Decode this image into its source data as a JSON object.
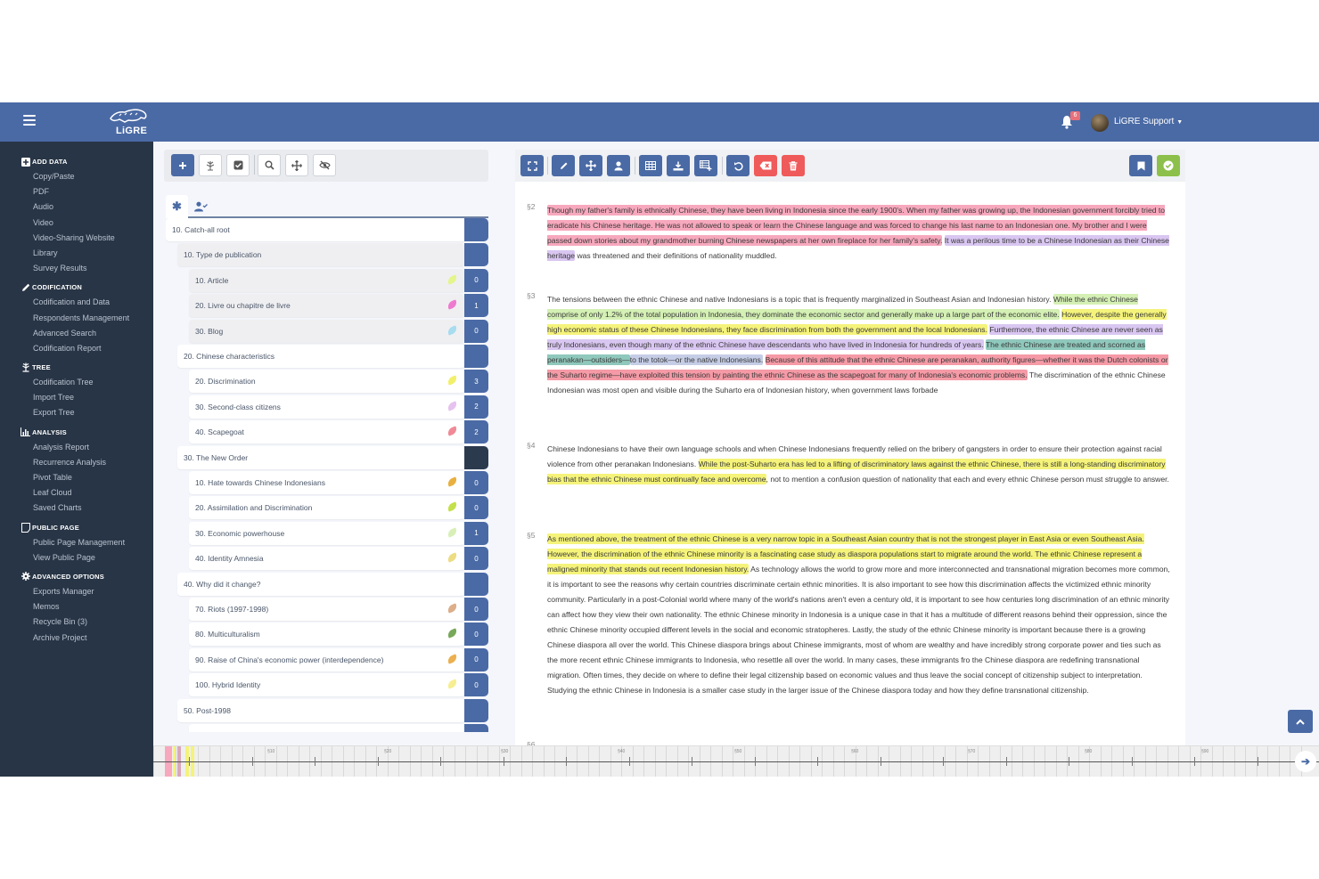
{
  "header": {
    "logo_text": "LiGRE",
    "notifications_count": "6",
    "user_name": "LiGRE Support"
  },
  "sidebar": {
    "sections": [
      {
        "title": "ADD DATA",
        "icon": "plus-square-icon",
        "items": [
          "Copy/Paste",
          "PDF",
          "Audio",
          "Video",
          "Video-Sharing Website",
          "Library",
          "Survey Results"
        ]
      },
      {
        "title": "CODIFICATION",
        "icon": "pencil-icon",
        "items": [
          "Codification and Data",
          "Respondents Management",
          "Advanced Search",
          "Codification Report"
        ]
      },
      {
        "title": "TREE",
        "icon": "tree-icon",
        "items": [
          "Codification Tree",
          "Import Tree",
          "Export Tree"
        ]
      },
      {
        "title": "ANALYSIS",
        "icon": "bar-chart-icon",
        "items": [
          "Analysis Report",
          "Recurrence Analysis",
          "Pivot Table",
          "Leaf Cloud",
          "Saved Charts"
        ]
      },
      {
        "title": "PUBLIC PAGE",
        "icon": "page-icon",
        "items": [
          "Public Page Management",
          "View Public Page"
        ]
      },
      {
        "title": "ADVANCED OPTIONS",
        "icon": "gear-icon",
        "items": [
          "Exports Manager",
          "Memos",
          "Recycle Bin (3)",
          "Archive Project"
        ]
      }
    ]
  },
  "tree_toolbar": {
    "buttons": [
      "add-icon",
      "tree-icon",
      "checkbox-icon",
      "search-icon",
      "move-icon",
      "hide-icon"
    ]
  },
  "tree_tabs": [
    "asterisk-icon",
    "user-check-icon"
  ],
  "tree": {
    "nodes": [
      {
        "label": "10. Catch-all root",
        "level": 0,
        "count": "",
        "leaf_color": ""
      },
      {
        "label": "10. Type de publication",
        "level": 1,
        "count": "",
        "leaf_color": ""
      },
      {
        "label": "10. Article",
        "level": 2,
        "count": "0",
        "leaf_color": "#e4f58a"
      },
      {
        "label": "20. Livre ou chapitre de livre",
        "level": 2,
        "count": "1",
        "leaf_color": "#ee7ad0"
      },
      {
        "label": "30. Blog",
        "level": 2,
        "count": "0",
        "leaf_color": "#a8dcef"
      },
      {
        "label": "20. Chinese characteristics",
        "level": 1,
        "count": "",
        "leaf_color": ""
      },
      {
        "label": "20. Discrimination",
        "level": 2,
        "count": "3",
        "leaf_color": "#f2f06a"
      },
      {
        "label": "30. Second-class citizens",
        "level": 2,
        "count": "2",
        "leaf_color": "#e6c2ee"
      },
      {
        "label": "40. Scapegoat",
        "level": 2,
        "count": "2",
        "leaf_color": "#f08a96"
      },
      {
        "label": "30. The New Order",
        "level": 1,
        "count": "",
        "leaf_color": "",
        "dark": true
      },
      {
        "label": "10. Hate towards Chinese Indonesians",
        "level": 2,
        "count": "0",
        "leaf_color": "#e8b040"
      },
      {
        "label": "20. Assimilation and Discrimination",
        "level": 2,
        "count": "0",
        "leaf_color": "#c4e04a"
      },
      {
        "label": "30. Economic powerhouse",
        "level": 2,
        "count": "1",
        "leaf_color": "#d8f0b8"
      },
      {
        "label": "40. Identity Amnesia",
        "level": 2,
        "count": "0",
        "leaf_color": "#ecdc84"
      },
      {
        "label": "40. Why did it change?",
        "level": 1,
        "count": "",
        "leaf_color": ""
      },
      {
        "label": "70. Riots (1997-1998)",
        "level": 2,
        "count": "0",
        "leaf_color": "#dcae8a"
      },
      {
        "label": "80. Multiculturalism",
        "level": 2,
        "count": "0",
        "leaf_color": "#78a85a"
      },
      {
        "label": "90. Raise of China's economic power (interdependence)",
        "level": 2,
        "count": "0",
        "leaf_color": "#ecb050"
      },
      {
        "label": "100. Hybrid Identity",
        "level": 2,
        "count": "0",
        "leaf_color": "#f6ee90"
      },
      {
        "label": "50. Post-1998",
        "level": 1,
        "count": "",
        "leaf_color": ""
      },
      {
        "label": "",
        "level": 2,
        "count": "",
        "leaf_color": ""
      }
    ]
  },
  "doc_toolbar": {
    "buttons": [
      "fullscreen-icon",
      "pencil-icon",
      "move-icon",
      "user-icon",
      "table-icon",
      "download-icon",
      "add-media-icon",
      "undo-icon",
      "clear-icon",
      "trash-icon"
    ],
    "right_buttons": [
      "bookmark-icon",
      "check-icon"
    ]
  },
  "document": {
    "paragraphs": [
      {
        "num": "§2",
        "segments": [
          {
            "text": "Though my father's family is ethnically Chinese, they have been living in Indonesia since the early 1900's. When my father was growing up, the Indonesian government forcibly tried to eradicate his Chinese heritage. He was not allowed to speak or learn the Chinese language and was forced to change his last name to an Indonesian one. My brother and I were passed down stories about my grandmother burning Chinese newspapers at her own fireplace for her family's safety.",
            "hl": "pink"
          },
          {
            "text": " ",
            "hl": ""
          },
          {
            "text": "It was a perilous time to be a Chinese Indonesian as their Chinese heritage",
            "hl": "lilac"
          },
          {
            "text": " was threatened and their definitions of nationality muddled.",
            "hl": ""
          }
        ]
      },
      {
        "num": "§3",
        "segments": [
          {
            "text": "The tensions between the ethnic Chinese and native Indonesians is a topic that is frequently marginalized in Southeast Asian and Indonesian history. ",
            "hl": ""
          },
          {
            "text": "While the ethnic Chinese comprise of only 1.2% of the total population in Indonesia, they dominate the economic sector and generally make up a large part of the economic elite.",
            "hl": "green"
          },
          {
            "text": " ",
            "hl": ""
          },
          {
            "text": "However, despite the generally high economic status of these Chinese Indonesians, they face discrimination from both the government and the local Indonesians.",
            "hl": "yellow"
          },
          {
            "text": " ",
            "hl": ""
          },
          {
            "text": "Furthermore, the ethnic Chinese are never seen as truly Indonesians, even though many of the ethnic Chinese have descendants who have lived in Indonesia for hundreds of years.",
            "hl": "lilac"
          },
          {
            "text": " ",
            "hl": ""
          },
          {
            "text": "The ethnic Chinese are treated and scorned as peranakan—outsiders—",
            "hl": "teal"
          },
          {
            "text": "to the totok—or the native Indonesians.",
            "hl": "blue-grey"
          },
          {
            "text": " ",
            "hl": ""
          },
          {
            "text": "Because of this attitude that the ethnic Chinese are peranakan, authority figures—whether it was the Dutch colonists or the Suharto regime—have exploited this tension by painting the ethnic Chinese as the scapegoat for many of Indonesia's economic problems.",
            "hl": "red"
          },
          {
            "text": " The discrimination of the ethnic Chinese Indonesian was most open and visible during the Suharto era of Indonesian history, when government laws forbade",
            "hl": ""
          }
        ]
      },
      {
        "num": "§4",
        "segments": [
          {
            "text": "Chinese Indonesians to have their own language schools and when Chinese Indonesians frequently relied on the bribery of gangsters in order to ensure their protection against racial violence from other peranakan Indonesians. ",
            "hl": ""
          },
          {
            "text": "While the post-Suharto era has led to a lifting of discriminatory laws against the ethnic Chinese, there is still a long-standing discriminatory bias that the ethnic Chinese must continually face and overcome",
            "hl": "yellow"
          },
          {
            "text": ", not to mention a confusion question of nationality that each and every ethnic Chinese person must struggle to answer.",
            "hl": ""
          }
        ]
      },
      {
        "num": "§5",
        "segments": [
          {
            "text": "As mentioned above, the treatment of the ethnic Chinese is a very narrow topic in a Southeast Asian country that is not the strongest player in East Asia or even Southeast Asia. However, the discrimination of the ethnic Chinese minority is a fascinating case study as diaspora populations start to migrate around the world. The ethnic Chinese represent a maligned minority that stands out recent Indonesian history.",
            "hl": "yellow"
          },
          {
            "text": " As technology allows the world to grow more and more interconnected and transnational migration becomes more common, it is important to see the reasons why certain countries discriminate certain ethnic minorities. It is also important to see how this discrimination affects the victimized ethnic minority community. Particularly in a post-Colonial world where many of the world's nations aren't even a century old, it is important to see how centuries long discrimination of an ethnic minority can affect how they view their own nationality. The ethnic Chinese minority in Indonesia is a unique case in that it has a multitude of different reasons behind their oppression, since the ethnic Chinese minority occupied different levels in the social and economic stratopheres. Lastly, the study of the ethnic Chinese minority is important because there is a growing Chinese diaspora all over the world. This Chinese diaspora brings about Chinese immigrants, most of whom are wealthy and have incredibly strong corporate power and ties such as the more recent ethnic Chinese immigrants to Indonesia, who resettle all over the world. In many cases, these immigrants fro the Chinese diaspora are redefining transnational migration. Often times, they decide on where to define their legal citizenship based on economic values and thus leave the social concept of citizenship subject to interpretation. Studying the ethnic Chinese in Indonesia is a smaller case study in the larger issue of the Chinese diaspora today and how they define transnational citizenship.",
            "hl": ""
          }
        ]
      }
    ],
    "next_paragraph_num": "§6"
  },
  "timeline": {
    "labels": [
      "§10",
      "§20",
      "§30",
      "§40",
      "§50",
      "§60",
      "§70",
      "§80",
      "§90"
    ],
    "highlight_colors": [
      "#f7a8bd",
      "#d9c6f1",
      "#f5f37a",
      "#d8a8b8"
    ]
  },
  "colors": {
    "brand": "#4a6aa5",
    "sidebar_bg": "#283546",
    "danger": "#ef5a5a",
    "success": "#8cc04a"
  }
}
